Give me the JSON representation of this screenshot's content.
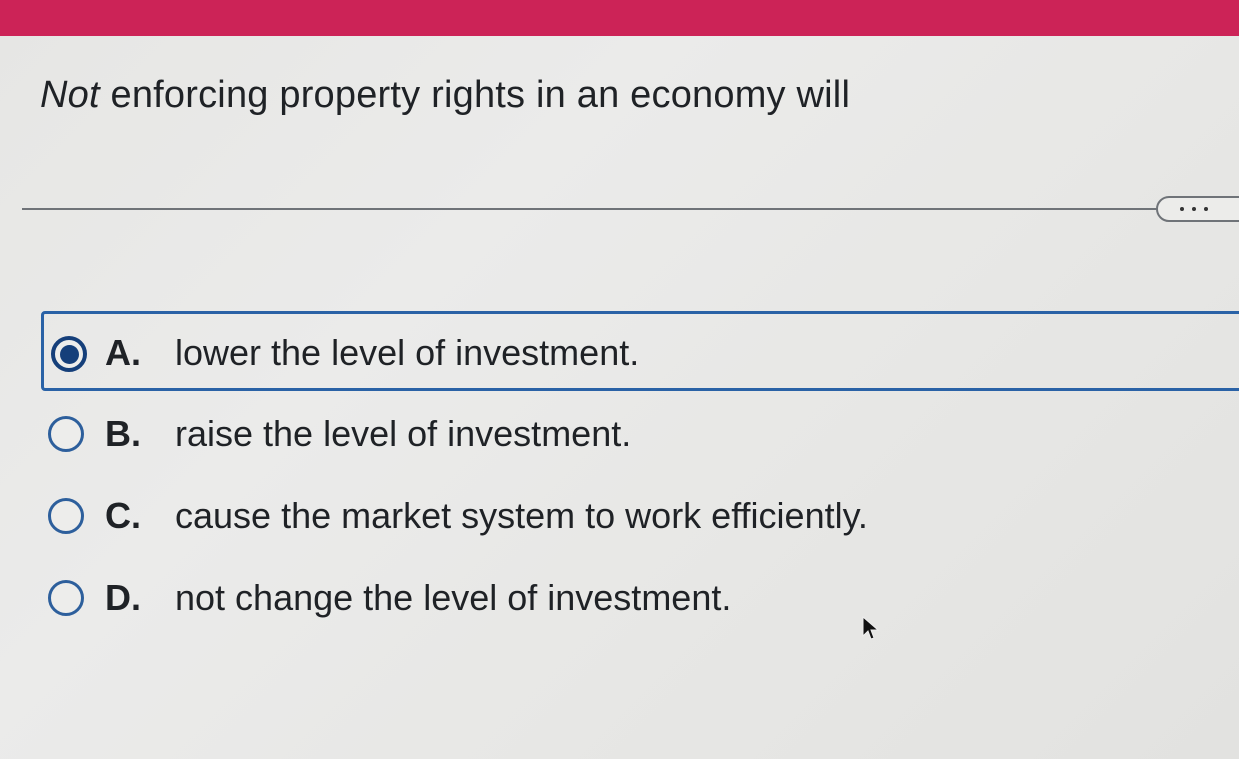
{
  "header": {
    "bar_color": "#cc2357"
  },
  "question": {
    "emphasis": "Not",
    "rest": " enforcing property rights in an economy will"
  },
  "more_button": {
    "icon": "ellipsis-icon"
  },
  "options": [
    {
      "letter": "A.",
      "text": "lower the level of investment.",
      "selected": true
    },
    {
      "letter": "B.",
      "text": "raise the level of investment.",
      "selected": false
    },
    {
      "letter": "C.",
      "text": "cause the market system to work efficiently.",
      "selected": false
    },
    {
      "letter": "D.",
      "text": "not change the level of investment.",
      "selected": false
    }
  ],
  "colors": {
    "accent": "#2a62a6",
    "radio_checked": "#153f7a"
  },
  "cursor": {
    "icon": "mouse-pointer-icon"
  }
}
